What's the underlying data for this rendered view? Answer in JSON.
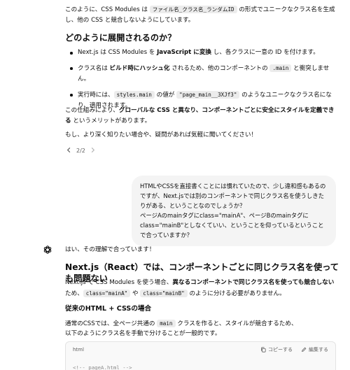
{
  "intro": {
    "pre": "このように、CSS Modules は ",
    "code": "ファイル名_クラス名_ランダムID",
    "post": " の形式でユニークなクラス名を生成し、他の CSS と競合しないようにしています。"
  },
  "section1": {
    "heading": "どのように展開されるのか？",
    "bullets": [
      {
        "a": "Next.js は CSS Modules を ",
        "b": "JavaScript に変換",
        "c": " し、各クラスに一意の ID を付けます。"
      },
      {
        "a": "クラス名は ",
        "b": "ビルド時にハッシュ化",
        "c": " されるため、他のコンポーネントの ",
        "code": ".main",
        "d": " と衝突しません。"
      },
      {
        "a": "実行時には、",
        "code": "styles.main",
        "b": " の値が ",
        "code2": "\"page_main__3XJf3\"",
        "c": " のようなユニークなクラス名になり、適用されます。"
      }
    ]
  },
  "summary": {
    "pre": "この仕組みにより、",
    "bold": "グローバルな CSS と異なり、コンポーネントごとに安全にスタイルを定義できる",
    "post": " というメリットがあります。"
  },
  "closing": "もし、より深く知りたい場合や、疑問があれば気軽に聞いてください！",
  "pager": {
    "label": "2/2"
  },
  "user_message": "HTMLやCSSを直接書くことには慣れていたので、少し違和感もあるのですが、Next.jsでは別のコンポーネントで同じクラス名を使うしきたりがある、ということなのでしょうか？\nページAのmainタグにclass=\"mainA\"、ページBのmainタグにclass=\"mainB\"としなくていい、ということを仰っているということで合っていますか？",
  "answer": {
    "lead": "はい、その理解で合っています！",
    "heading": "Next.js（React）では、コンポーネントごとに同じクラス名を使っても問題ない",
    "para_pre": "Next.js で CSS Modules を使う場合、",
    "para_bold": "異なるコンポーネントで同じクラス名を使っても競合しない",
    "para_post": " ため、",
    "code1": "class=\"mainA\"",
    "para_mid": " や ",
    "code2": "class=\"mainB\"",
    "para_end": " のように分ける必要がありません。",
    "sub_heading": "従来のHTML + CSSの場合",
    "p2_pre": "通常のCSSでは、全ページ共通の ",
    "p2_code": "main",
    "p2_post": " クラスを作ると、スタイルが競合するため、",
    "p3": "以下のようにクラス名を手動で分けることが一般的です。"
  },
  "codeblock": {
    "lang": "html",
    "copy_label": "コピーする",
    "edit_label": "編集する",
    "first_line": "<!-- pageA.html -->"
  }
}
